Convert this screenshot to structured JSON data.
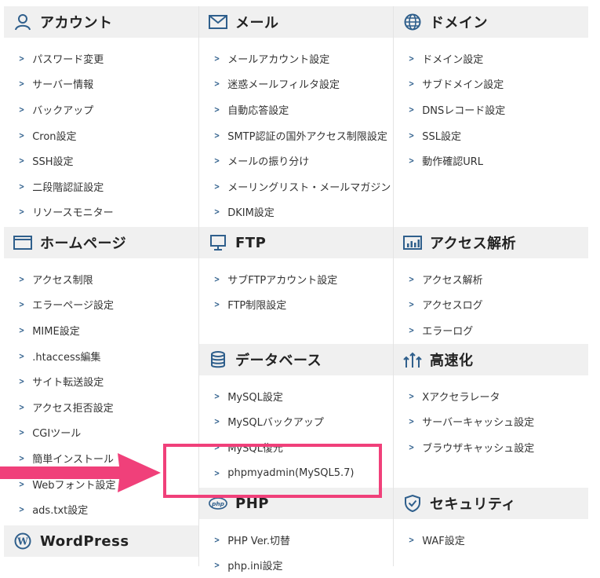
{
  "sections": {
    "account": {
      "title": "アカウント",
      "icon": "person-icon",
      "items": [
        "パスワード変更",
        "サーバー情報",
        "バックアップ",
        "Cron設定",
        "SSH設定",
        "二段階認証設定",
        "リソースモニター"
      ]
    },
    "mail": {
      "title": "メール",
      "icon": "envelope-icon",
      "items": [
        "メールアカウント設定",
        "迷惑メールフィルタ設定",
        "自動応答設定",
        "SMTP認証の国外アクセス制限設定",
        "メールの振り分け",
        "メーリングリスト・メールマガジン",
        "DKIM設定"
      ]
    },
    "domain": {
      "title": "ドメイン",
      "icon": "globe-icon",
      "items": [
        "ドメイン設定",
        "サブドメイン設定",
        "DNSレコード設定",
        "SSL設定",
        "動作確認URL"
      ]
    },
    "homepage": {
      "title": "ホームページ",
      "icon": "browser-window-icon",
      "items": [
        "アクセス制限",
        "エラーページ設定",
        "MIME設定",
        ".htaccess編集",
        "サイト転送設定",
        "アクセス拒否設定",
        "CGIツール",
        "簡単インストール",
        "Webフォント設定",
        "ads.txt設定"
      ]
    },
    "ftp": {
      "title": "FTP",
      "icon": "monitor-icon",
      "items": [
        "サブFTPアカウント設定",
        "FTP制限設定"
      ]
    },
    "access_analysis": {
      "title": "アクセス解析",
      "icon": "bar-chart-icon",
      "items": [
        "アクセス解析",
        "アクセスログ",
        "エラーログ"
      ]
    },
    "database": {
      "title": "データベース",
      "icon": "database-icon",
      "items": [
        "MySQL設定",
        "MySQLバックアップ",
        "MySQL復元",
        "phpmyadmin(MySQL5.7)"
      ]
    },
    "speedup": {
      "title": "高速化",
      "icon": "speed-arrows-icon",
      "items": [
        "Xアクセラレータ",
        "サーバーキャッシュ設定",
        "ブラウザキャッシュ設定"
      ]
    },
    "php": {
      "title": "PHP",
      "icon": "php-icon",
      "items": [
        "PHP Ver.切替",
        "php.ini設定"
      ]
    },
    "security": {
      "title": "セキュリティ",
      "icon": "shield-icon",
      "items": [
        "WAF設定"
      ]
    },
    "wordpress": {
      "title": "WordPress",
      "icon": "wordpress-icon",
      "items": []
    }
  },
  "annotation": {
    "highlight_color": "#f0407a",
    "arrow_color": "#f0407a",
    "highlighted_item": "phpmyadmin(MySQL5.7)"
  },
  "colors": {
    "header_bg": "#f0f0f0",
    "icon_blue": "#2f5f8c",
    "chevron": "#2f5f8c"
  }
}
